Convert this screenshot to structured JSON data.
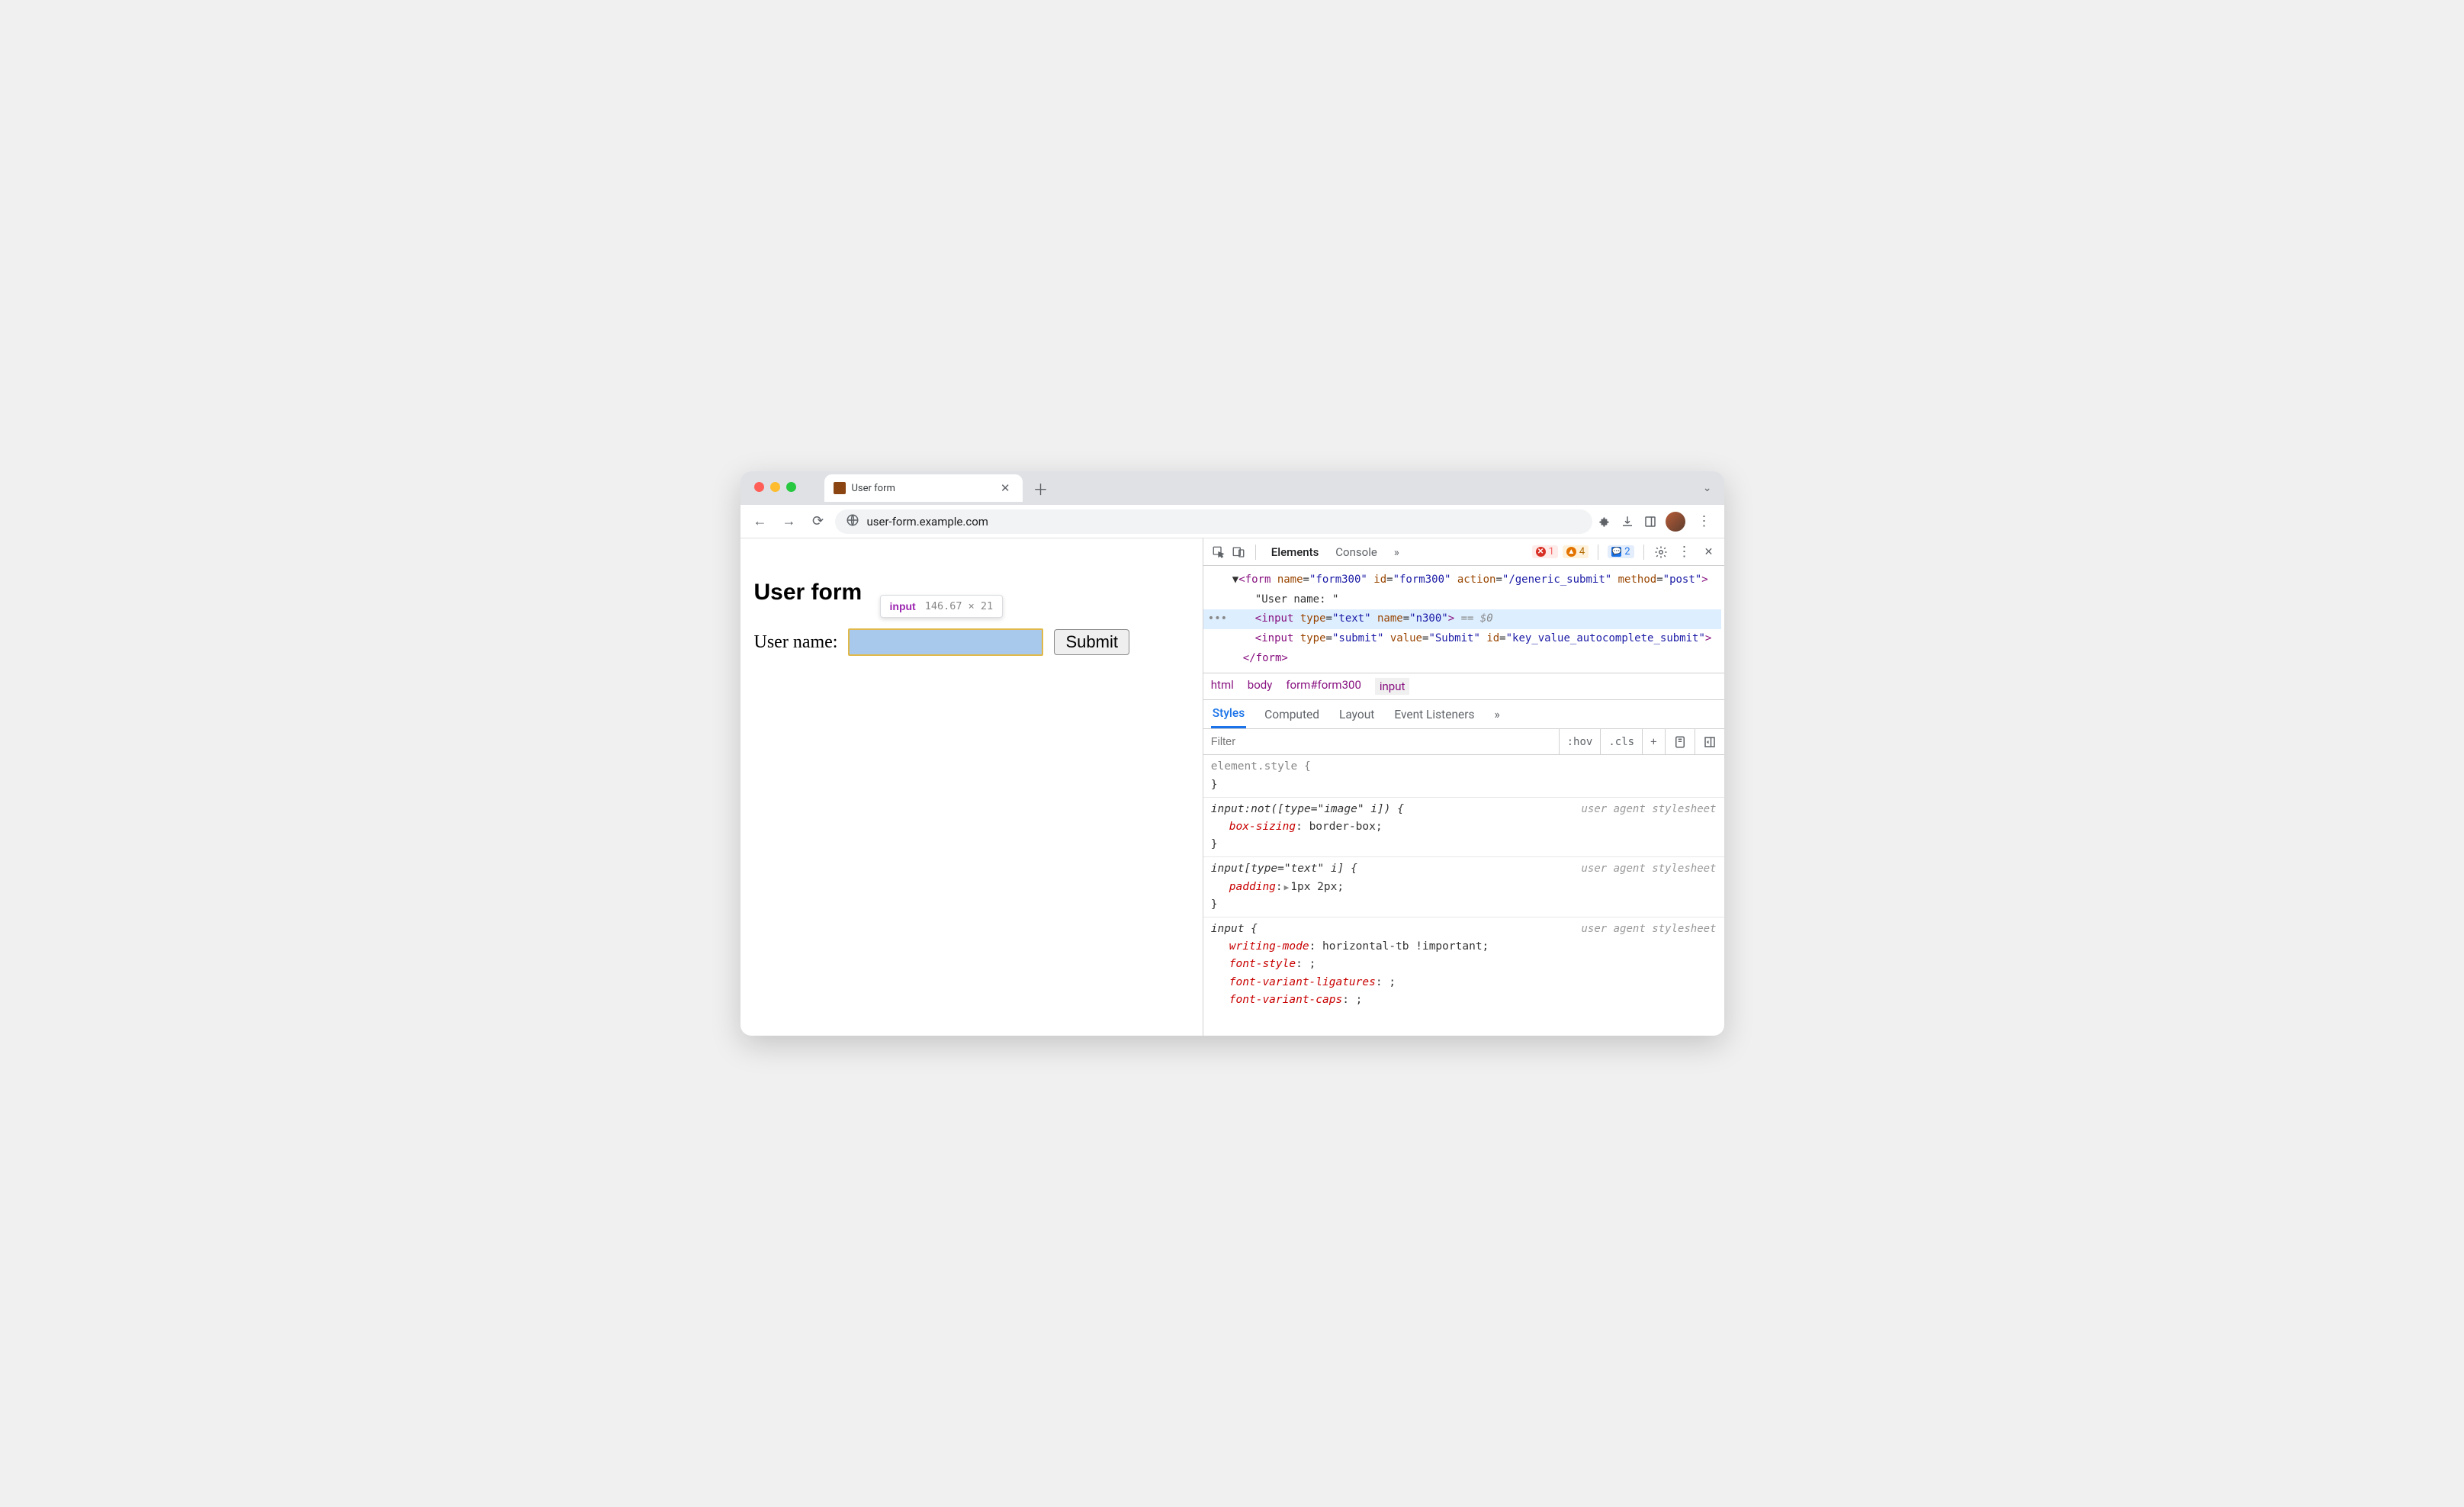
{
  "browser": {
    "tab_title": "User form",
    "url": "user-form.example.com"
  },
  "page": {
    "heading": "User form",
    "label": "User name:",
    "submit_label": "Submit",
    "inspect_tag": "input",
    "inspect_dims": "146.67 × 21"
  },
  "devtools": {
    "tabs": {
      "elements": "Elements",
      "console": "Console",
      "more": "»"
    },
    "badges": {
      "errors": "1",
      "warnings": "4",
      "info": "2"
    },
    "dom": {
      "form_open": "<form name=\"form300\" id=\"form300\" action=\"/generic_submit\" method=\"post\">",
      "text_node": "\"User name: \"",
      "input_sel": "<input type=\"text\" name=\"n300\">",
      "sel_marker": "== $0",
      "input_submit": "<input type=\"submit\" value=\"Submit\" id=\"key_value_autocomplete_submit\">",
      "form_close": "</form>"
    },
    "crumbs": [
      "html",
      "body",
      "form#form300",
      "input"
    ],
    "subtabs": {
      "styles": "Styles",
      "computed": "Computed",
      "layout": "Layout",
      "events": "Event Listeners",
      "more": "»"
    },
    "filter_placeholder": "Filter",
    "actions": {
      "hov": ":hov",
      "cls": ".cls",
      "plus": "+"
    },
    "rules": {
      "element_style": "element.style {",
      "r1_sel": "input:not([type=\"image\" i]) {",
      "r1_p1": "box-sizing",
      "r1_v1": "border-box",
      "r2_sel": "input[type=\"text\" i] {",
      "r2_p1": "padding",
      "r2_v1": "1px 2px",
      "r3_sel": "input {",
      "r3_p1": "writing-mode",
      "r3_v1": "horizontal-tb !important",
      "r3_p2": "font-style",
      "r3_v2": "",
      "r3_p3": "font-variant-ligatures",
      "r3_v3": "",
      "r3_p4": "font-variant-caps",
      "r3_v4": "",
      "ua_note": "user agent stylesheet",
      "close": "}"
    }
  }
}
